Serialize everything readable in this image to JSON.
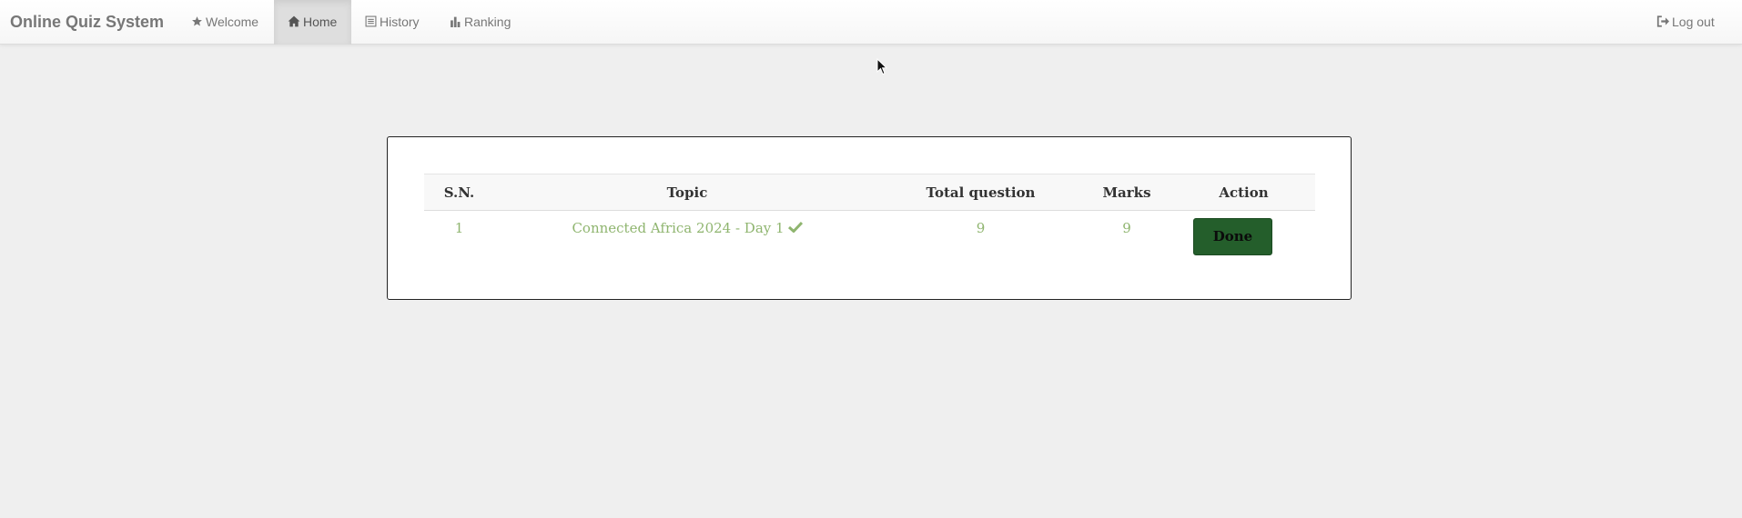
{
  "navbar": {
    "brand": "Online Quiz System",
    "items": [
      {
        "label": "Welcome",
        "icon": "star-icon",
        "active": false
      },
      {
        "label": "Home",
        "icon": "home-icon",
        "active": true
      },
      {
        "label": "History",
        "icon": "list-icon",
        "active": false
      },
      {
        "label": "Ranking",
        "icon": "bar-chart-icon",
        "active": false
      }
    ],
    "logout": {
      "label": "Log out",
      "icon": "logout-icon"
    }
  },
  "table": {
    "headers": [
      "S.N.",
      "Topic",
      "Total question",
      "Marks",
      "Action"
    ],
    "rows": [
      {
        "sn": "1",
        "topic": "Connected Africa 2024 - Day 1",
        "status_icon": "check-icon",
        "total_questions": "9",
        "marks": "9",
        "action_label": "Done"
      }
    ]
  },
  "colors": {
    "background": "#efefef",
    "link_green": "#8fb56f",
    "button_green": "#245e2b",
    "nav_text": "#777777"
  }
}
